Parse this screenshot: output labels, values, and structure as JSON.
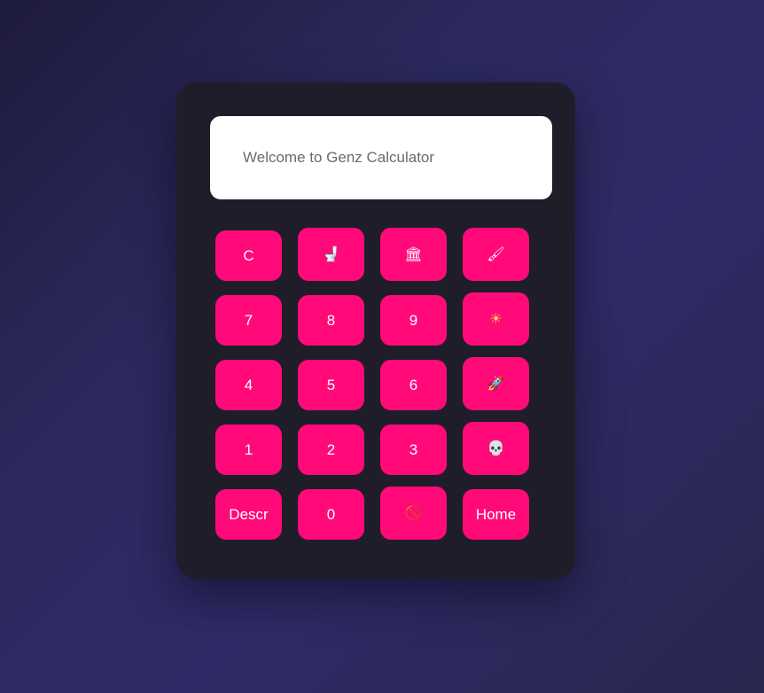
{
  "display": {
    "placeholder": "Welcome to Genz Calculator"
  },
  "buttons": {
    "clear": "C",
    "toilet": "🚽",
    "bank": "🏛",
    "paint": "🖌",
    "seven": "7",
    "eight": "8",
    "nine": "9",
    "sun": "☀",
    "four": "4",
    "five": "5",
    "six": "6",
    "rocket": "🚀",
    "one": "1",
    "two": "2",
    "three": "3",
    "skull": "💀",
    "descr": "Descr",
    "zero": "0",
    "no": "🚫",
    "home": "Home"
  },
  "colors": {
    "accent": "#ff0a78",
    "panel": "#1f1d29",
    "display_bg": "#ffffff"
  }
}
